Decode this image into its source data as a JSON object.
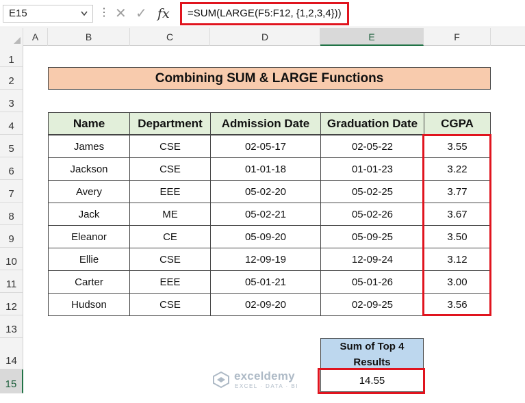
{
  "formula_bar": {
    "name_box": "E15",
    "dots": "⋮",
    "cancel_symbol": "✕",
    "enter_symbol": "✓",
    "fx_label": "fx",
    "formula": "=SUM(LARGE(F5:F12, {1,2,3,4}))"
  },
  "columns": [
    "A",
    "B",
    "C",
    "D",
    "E",
    "F"
  ],
  "rows": [
    "1",
    "2",
    "3",
    "4",
    "5",
    "6",
    "7",
    "8",
    "9",
    "10",
    "11",
    "12",
    "13",
    "14",
    "15"
  ],
  "title": "Combining SUM & LARGE Functions",
  "table": {
    "headers": [
      "Name",
      "Department",
      "Admission Date",
      "Graduation Date",
      "CGPA"
    ],
    "rows": [
      [
        "James",
        "CSE",
        "02-05-17",
        "02-05-22",
        "3.55"
      ],
      [
        "Jackson",
        "CSE",
        "01-01-18",
        "01-01-23",
        "3.22"
      ],
      [
        "Avery",
        "EEE",
        "05-02-20",
        "05-02-25",
        "3.77"
      ],
      [
        "Jack",
        "ME",
        "05-02-21",
        "05-02-26",
        "3.67"
      ],
      [
        "Eleanor",
        "CE",
        "05-09-20",
        "05-09-25",
        "3.50"
      ],
      [
        "Ellie",
        "CSE",
        "12-09-19",
        "12-09-24",
        "3.12"
      ],
      [
        "Carter",
        "EEE",
        "05-01-21",
        "05-01-26",
        "3.00"
      ],
      [
        "Hudson",
        "CSE",
        "02-09-20",
        "02-09-25",
        "3.56"
      ]
    ]
  },
  "result": {
    "label": "Sum of Top 4 Results",
    "value": "14.55"
  },
  "watermark": {
    "name": "exceldemy",
    "tagline": "EXCEL · DATA · BI"
  },
  "colors": {
    "title_fill": "#f8cbad",
    "header_fill": "#e2efda",
    "result_fill": "#bdd7ee",
    "highlight": "#e0141e",
    "excel_green": "#217346"
  }
}
